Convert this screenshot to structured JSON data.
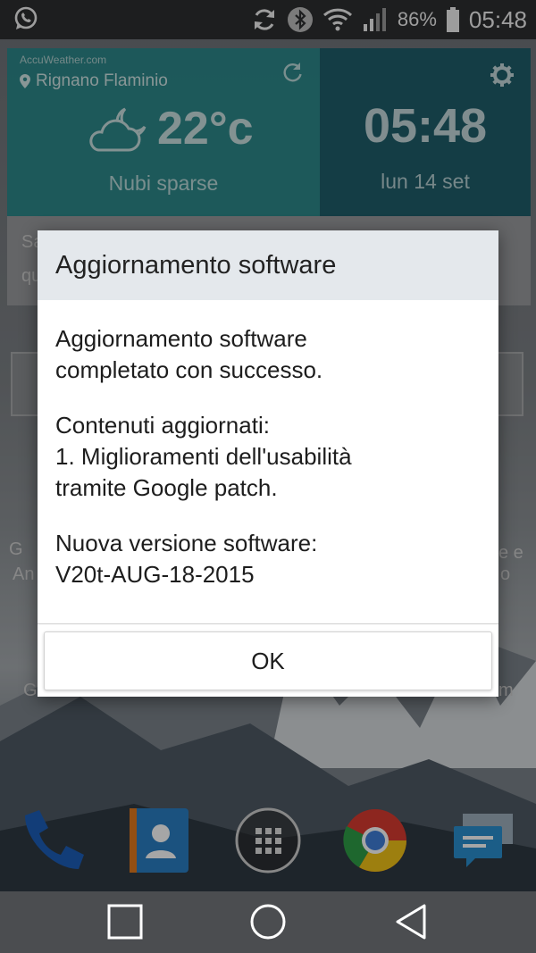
{
  "status_bar": {
    "battery_percent": "86%",
    "time": "05:48"
  },
  "weather_widget": {
    "brand": "AccuWeather.com",
    "location": "Rignano Flaminio",
    "temperature": "22°c",
    "condition": "Nubi sparse"
  },
  "clock_widget": {
    "time": "05:48",
    "date": "lun 14 set"
  },
  "dialog": {
    "title": "Aggiornamento software",
    "paragraph1_line1": "Aggiornamento software",
    "paragraph1_line2": "completato con successo.",
    "paragraph2_line1": "Contenuti aggiornati:",
    "paragraph2_line2": "1. Miglioramenti dell'usabilità",
    "paragraph2_line3": "tramite Google patch.",
    "paragraph3_line1": "Nuova versione software:",
    "paragraph3_line2": "V20t-AUG-18-2015",
    "ok_button": "OK"
  },
  "background_fragments": {
    "card_left_top": "Sa",
    "card_left_bottom": "qu",
    "app_left_1": "G",
    "app_left_2": "An",
    "app_right_1": "e e",
    "app_right_2": "o",
    "app_left_3": "G",
    "app_right_3": "m"
  },
  "icons": {
    "whatsapp": "whatsapp-icon",
    "sync": "sync-icon",
    "bluetooth": "bluetooth-icon",
    "wifi": "wifi-icon",
    "signal": "signal-icon",
    "battery": "battery-icon"
  },
  "colors": {
    "weather_panel": "#2a8a8c",
    "clock_panel": "#1f5f6b",
    "dialog_title_bg": "#e4e8ec"
  }
}
